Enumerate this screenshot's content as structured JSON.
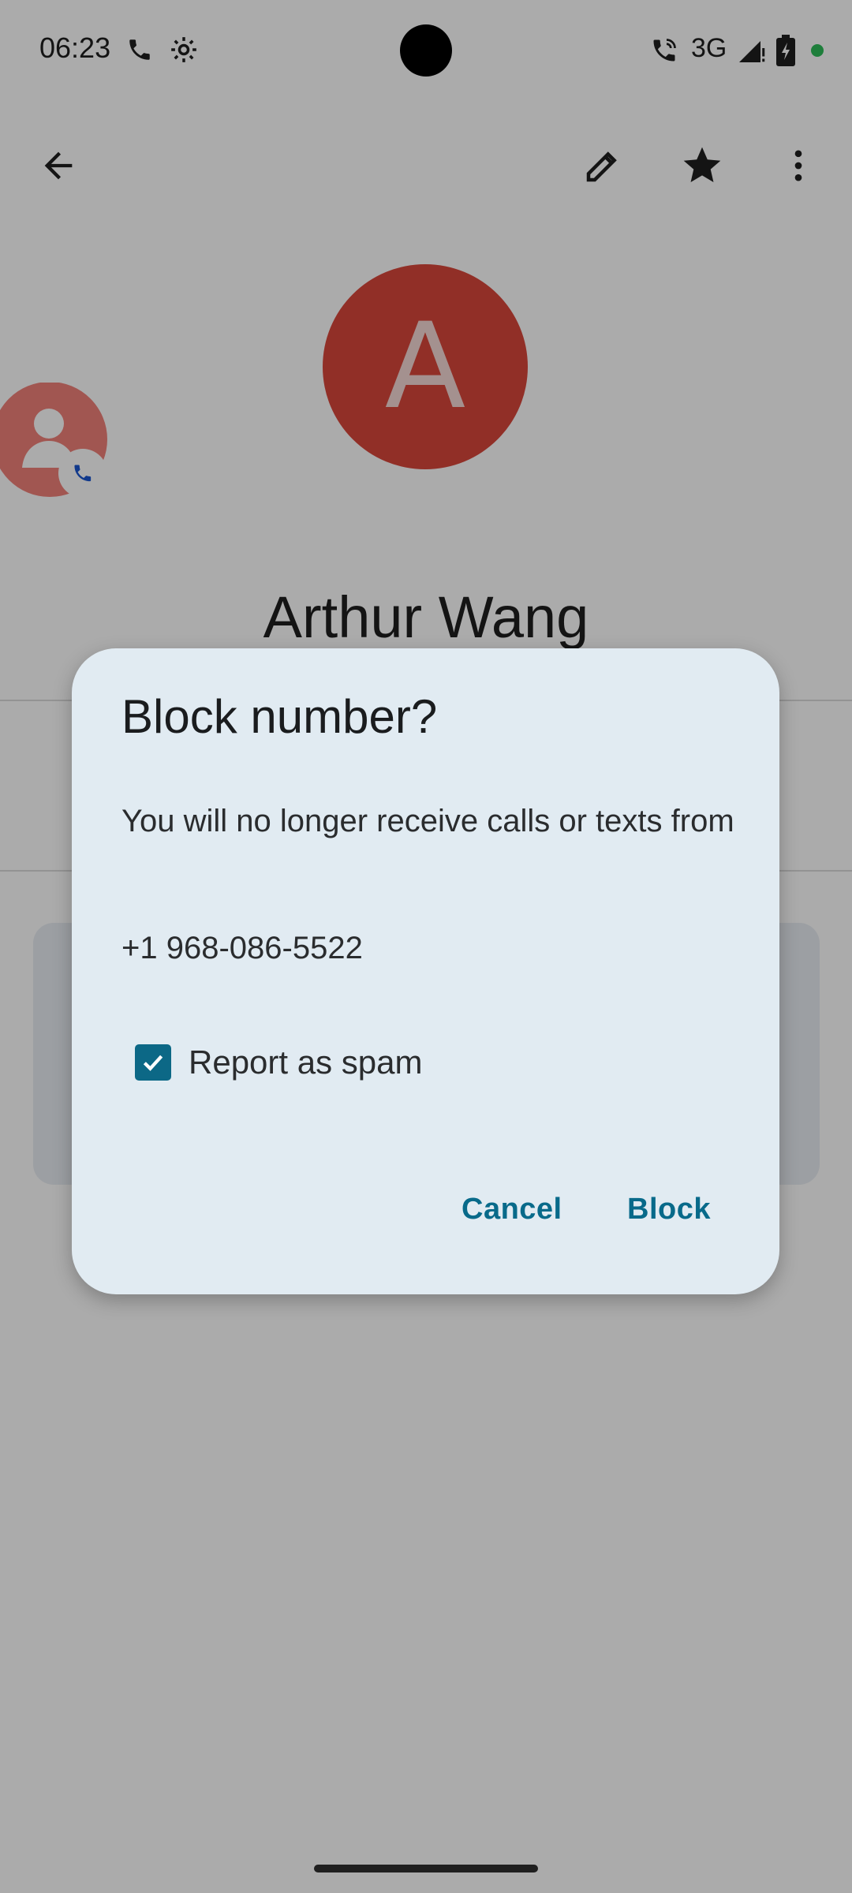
{
  "status_bar": {
    "time": "06:23",
    "network": "3G",
    "icons": [
      "phone-icon",
      "settings-gear-icon",
      "wifi-calling-icon",
      "signal-icon",
      "battery-charging-icon",
      "privacy-dot-icon"
    ]
  },
  "app_bar": {
    "icons": [
      "back-arrow-icon",
      "edit-pencil-icon",
      "star-icon",
      "more-vert-icon"
    ]
  },
  "contact": {
    "avatar_letter": "A",
    "avatar_color": "#d9463b",
    "name": "Arthur Wang"
  },
  "dialog": {
    "title": "Block number?",
    "message": "You will no longer receive calls or texts from",
    "number": "+1 968-086-5522",
    "report_spam_label": "Report as spam",
    "report_spam_checked": true,
    "cancel_label": "Cancel",
    "block_label": "Block"
  },
  "colors": {
    "accent": "#0c6886",
    "dialog_bg": "#e1ebf2",
    "button_text": "#086a8a"
  }
}
